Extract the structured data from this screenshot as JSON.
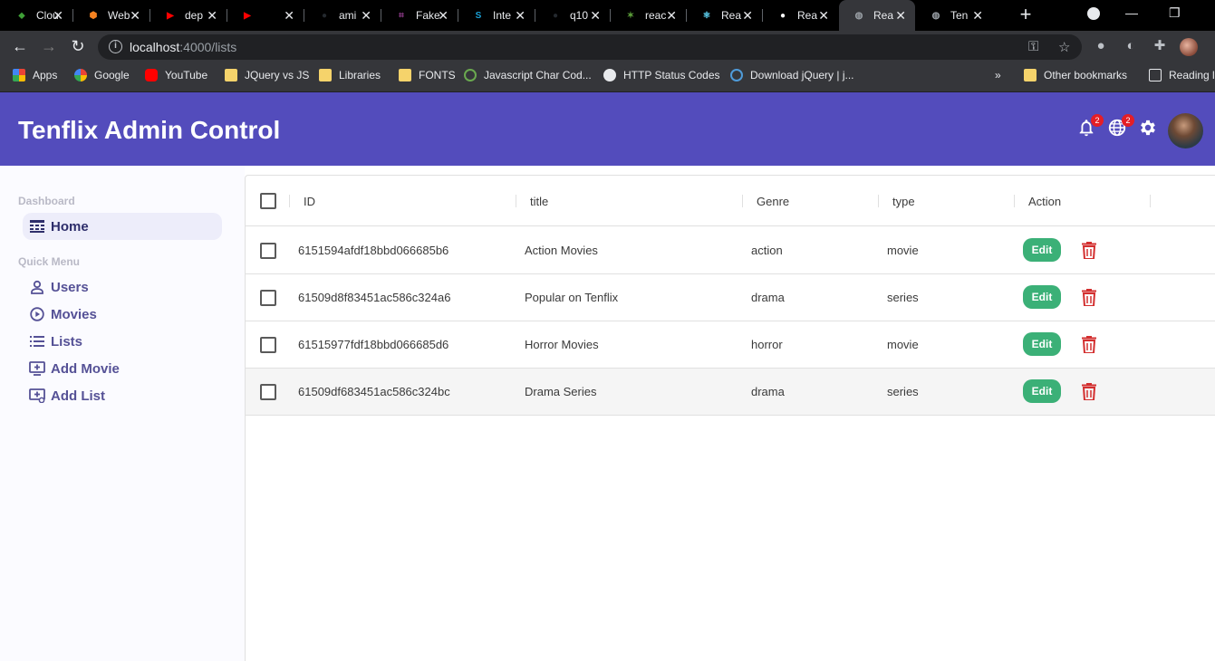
{
  "browser": {
    "tabs": [
      {
        "label": "Clou",
        "color": "#3fa037",
        "glyph": "⬥"
      },
      {
        "label": "Web",
        "color": "#f58220",
        "glyph": "⬢"
      },
      {
        "label": "dep",
        "color": "#ff0000",
        "glyph": "▶"
      },
      {
        "label": "",
        "color": "#ff0000",
        "glyph": "▶"
      },
      {
        "label": "ami",
        "color": "#24292e",
        "glyph": "●"
      },
      {
        "label": "Fake",
        "color": "#8e3b8a",
        "glyph": "⌗"
      },
      {
        "label": "Inte",
        "color": "#1aa1d6",
        "glyph": "S"
      },
      {
        "label": "q10",
        "color": "#24292e",
        "glyph": "●"
      },
      {
        "label": "reac",
        "color": "#5c9f3a",
        "glyph": "✶"
      },
      {
        "label": "Rea",
        "color": "#61dafb",
        "glyph": "⚛"
      },
      {
        "label": "Rea",
        "color": "#ffffff",
        "glyph": "●"
      },
      {
        "label": "Rea",
        "color": "#9aa0a6",
        "glyph": "◍"
      },
      {
        "label": "Ten",
        "color": "#9aa0a6",
        "glyph": "◍"
      }
    ],
    "url_host": "localhost",
    "url_rest": ":4000/lists",
    "bookmarks": [
      {
        "label": "Apps",
        "kind": "apps"
      },
      {
        "label": "Google",
        "kind": "google"
      },
      {
        "label": "YouTube",
        "kind": "youtube"
      },
      {
        "label": "JQuery vs JS",
        "kind": "folder"
      },
      {
        "label": "Libraries",
        "kind": "folder"
      },
      {
        "label": "FONTS",
        "kind": "folder"
      },
      {
        "label": "Javascript Char Cod...",
        "kind": "site"
      },
      {
        "label": "HTTP Status Codes",
        "kind": "globe"
      },
      {
        "label": "Download jQuery | j...",
        "kind": "jquery"
      }
    ],
    "bookmarks_more": "»",
    "other_bookmarks": "Other bookmarks",
    "reading_list": "Reading li"
  },
  "header": {
    "title": "Tenflix Admin Control",
    "notifications_badge": "2",
    "language_badge": "2"
  },
  "sidebar": {
    "section_dashboard": "Dashboard",
    "section_quick": "Quick Menu",
    "items": [
      {
        "label": "Home",
        "icon": "home-icon"
      },
      {
        "label": "Users",
        "icon": "user-icon"
      },
      {
        "label": "Movies",
        "icon": "play-circle-icon"
      },
      {
        "label": "Lists",
        "icon": "list-icon"
      },
      {
        "label": "Add Movie",
        "icon": "add-box-icon"
      },
      {
        "label": "Add List",
        "icon": "add-list-icon"
      }
    ]
  },
  "table": {
    "columns": [
      "ID",
      "title",
      "Genre",
      "type",
      "Action"
    ],
    "edit_label": "Edit",
    "rows": [
      {
        "id": "6151594afdf18bbd066685b6",
        "title": "Action Movies",
        "genre": "action",
        "type": "movie"
      },
      {
        "id": "61509d8f83451ac586c324a6",
        "title": "Popular on Tenflix",
        "genre": "drama",
        "type": "series"
      },
      {
        "id": "61515977fdf18bbd066685d6",
        "title": "Horror Movies",
        "genre": "horror",
        "type": "movie"
      },
      {
        "id": "61509df683451ac586c324bc",
        "title": "Drama Series",
        "genre": "drama",
        "type": "series"
      }
    ]
  },
  "colors": {
    "header_bg": "#534cbc",
    "edit_green": "#3bb077",
    "delete_red": "#d32f2f"
  }
}
